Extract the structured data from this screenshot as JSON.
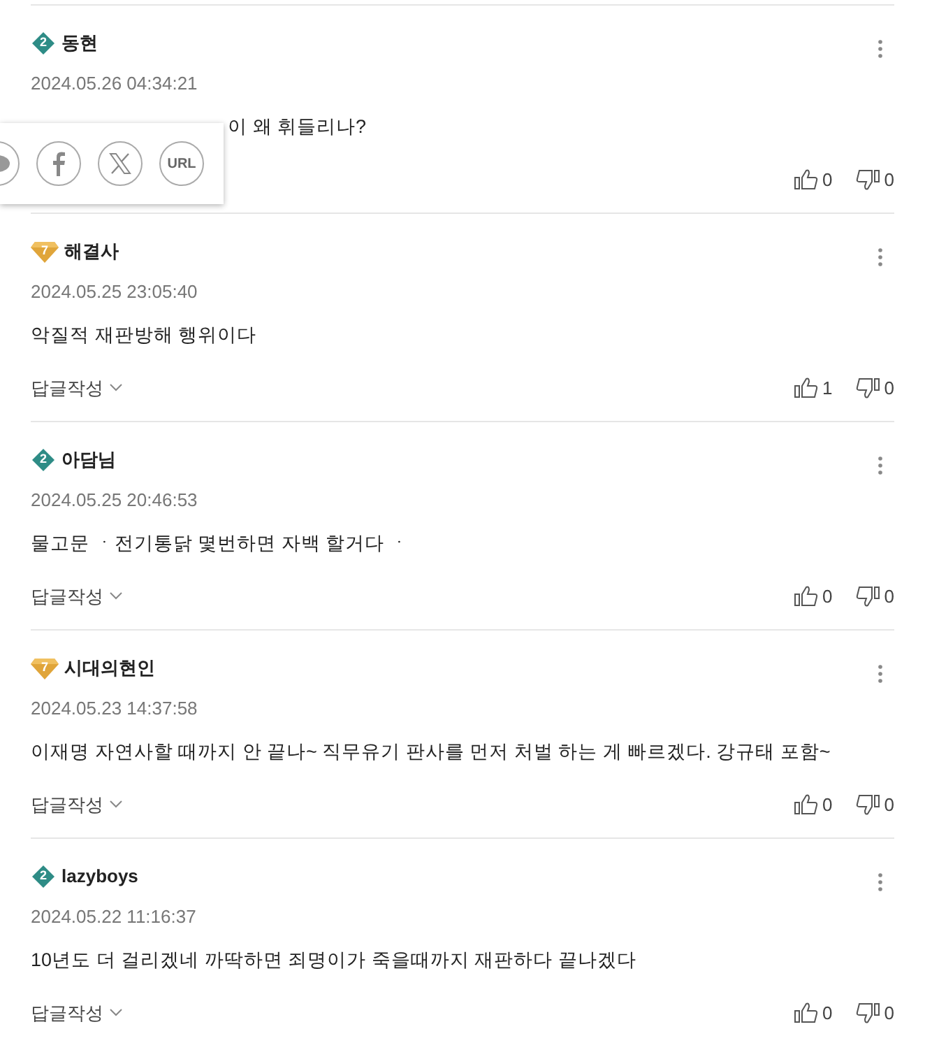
{
  "comments": [
    {
      "badge": {
        "kind": "diamond",
        "number": "2"
      },
      "author": "동현",
      "date": "2024.05.26 04:34:21",
      "text": "이 왜 휘들리나?",
      "likes": "0",
      "dislikes": "0",
      "share_popup": {
        "url_label": "URL"
      }
    },
    {
      "badge": {
        "kind": "gem",
        "number": "7"
      },
      "author": "해결사",
      "date": "2024.05.25 23:05:40",
      "text": "악질적 재판방해 행위이다",
      "reply": "답글작성",
      "likes": "1",
      "dislikes": "0"
    },
    {
      "badge": {
        "kind": "diamond",
        "number": "2"
      },
      "author": "아담님",
      "date": "2024.05.25 20:46:53",
      "text": "물고문 ㆍ전기통닭 몇번하면 자백 할거다 ㆍ",
      "reply": "답글작성",
      "likes": "0",
      "dislikes": "0"
    },
    {
      "badge": {
        "kind": "gem",
        "number": "7"
      },
      "author": "시대의현인",
      "date": "2024.05.23 14:37:58",
      "text": "이재명 자연사할 때까지 안 끝나~ 직무유기 판사를 먼저 처벌 하는 게 빠르겠다. 강규태 포함~",
      "reply": "답글작성",
      "likes": "0",
      "dislikes": "0"
    },
    {
      "badge": {
        "kind": "diamond",
        "number": "2"
      },
      "author": "lazyboys",
      "date": "2024.05.22 11:16:37",
      "text": "10년도 더 걸리겠네 까딱하면 죄명이가 죽을때까지 재판하다 끝나겠다",
      "reply": "답글작성",
      "likes": "0",
      "dislikes": "0"
    }
  ]
}
